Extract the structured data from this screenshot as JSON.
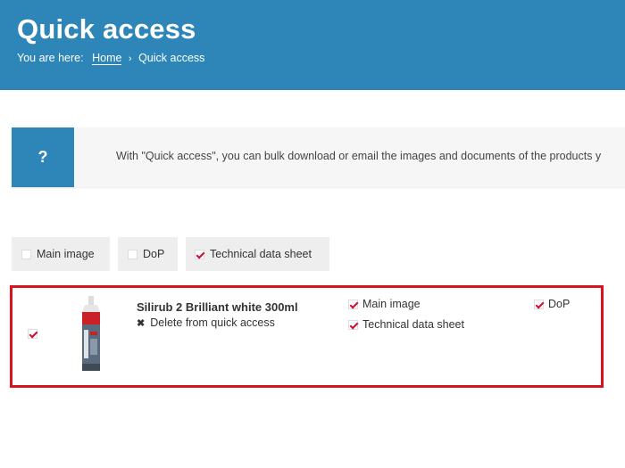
{
  "header": {
    "title": "Quick access",
    "breadcrumb_prefix": "You are here:",
    "breadcrumb_home": "Home",
    "breadcrumb_separator": "›",
    "breadcrumb_current": "Quick access",
    "background_color": "#2e86b8"
  },
  "info": {
    "icon_label": "?",
    "text": "With \"Quick access\", you can bulk download or email the images and documents of the products y"
  },
  "filters": [
    {
      "label": "Main image",
      "checked": false
    },
    {
      "label": "DoP",
      "checked": false
    },
    {
      "label": "Technical data sheet",
      "checked": true
    }
  ],
  "product": {
    "name": "Silirub 2 Brilliant white 300ml",
    "delete_label": "Delete from quick access",
    "selected": true,
    "documents": [
      {
        "label": "Main image",
        "checked": true
      },
      {
        "label": "Technical data sheet",
        "checked": true
      },
      {
        "label": "DoP",
        "checked": true
      }
    ]
  },
  "accent_color": "#c8102e"
}
